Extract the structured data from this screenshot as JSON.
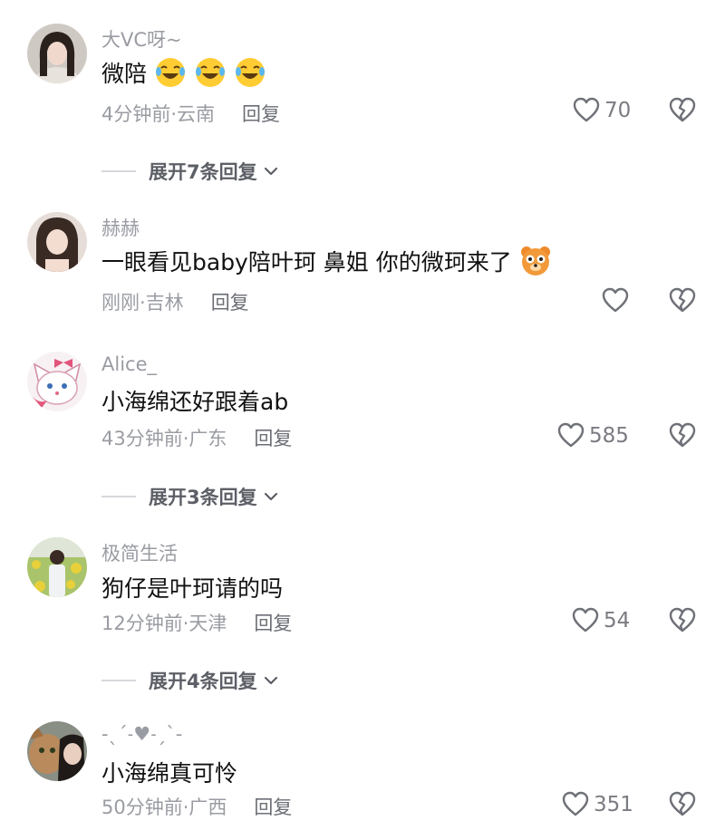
{
  "comments": [
    {
      "username": "大VC呀~",
      "text": "微陪",
      "emojis": [
        "laughing-tears-icon",
        "laughing-tears-icon",
        "laughing-tears-icon"
      ],
      "time": "4分钟前",
      "location": "云南",
      "time_location": "4分钟前·云南",
      "reply_label": "回复",
      "likes": "70",
      "expand_label": "展开7条回复"
    },
    {
      "username": "赫赫",
      "text": "一眼看见baby陪叶珂 鼻姐 你的微珂来了",
      "emojis": [
        "bear-face-icon"
      ],
      "time": "刚刚",
      "location": "吉林",
      "time_location": "刚刚·吉林",
      "reply_label": "回复",
      "likes": ""
    },
    {
      "username": "Alice_",
      "text": "小海绵还好跟着ab",
      "emojis": [],
      "time": "43分钟前",
      "location": "广东",
      "time_location": "43分钟前·广东",
      "reply_label": "回复",
      "likes": "585",
      "expand_label": "展开3条回复"
    },
    {
      "username": "极简生活",
      "text": "狗仔是叶珂请的吗",
      "emojis": [],
      "time": "12分钟前",
      "location": "天津",
      "time_location": "12分钟前·天津",
      "reply_label": "回复",
      "likes": "54",
      "expand_label": "展开4条回复"
    },
    {
      "username": "-ˎˊ˗♥︎˗ˏˋ-",
      "text": "小海绵真可怜",
      "emojis": [],
      "time": "50分钟前",
      "location": "广西",
      "time_location": "50分钟前·广西",
      "reply_label": "回复",
      "likes": "351"
    }
  ],
  "colors": {
    "secondary_text": "#9a9ca3",
    "primary_text": "#111111",
    "icon_gray": "#7a7c82"
  }
}
